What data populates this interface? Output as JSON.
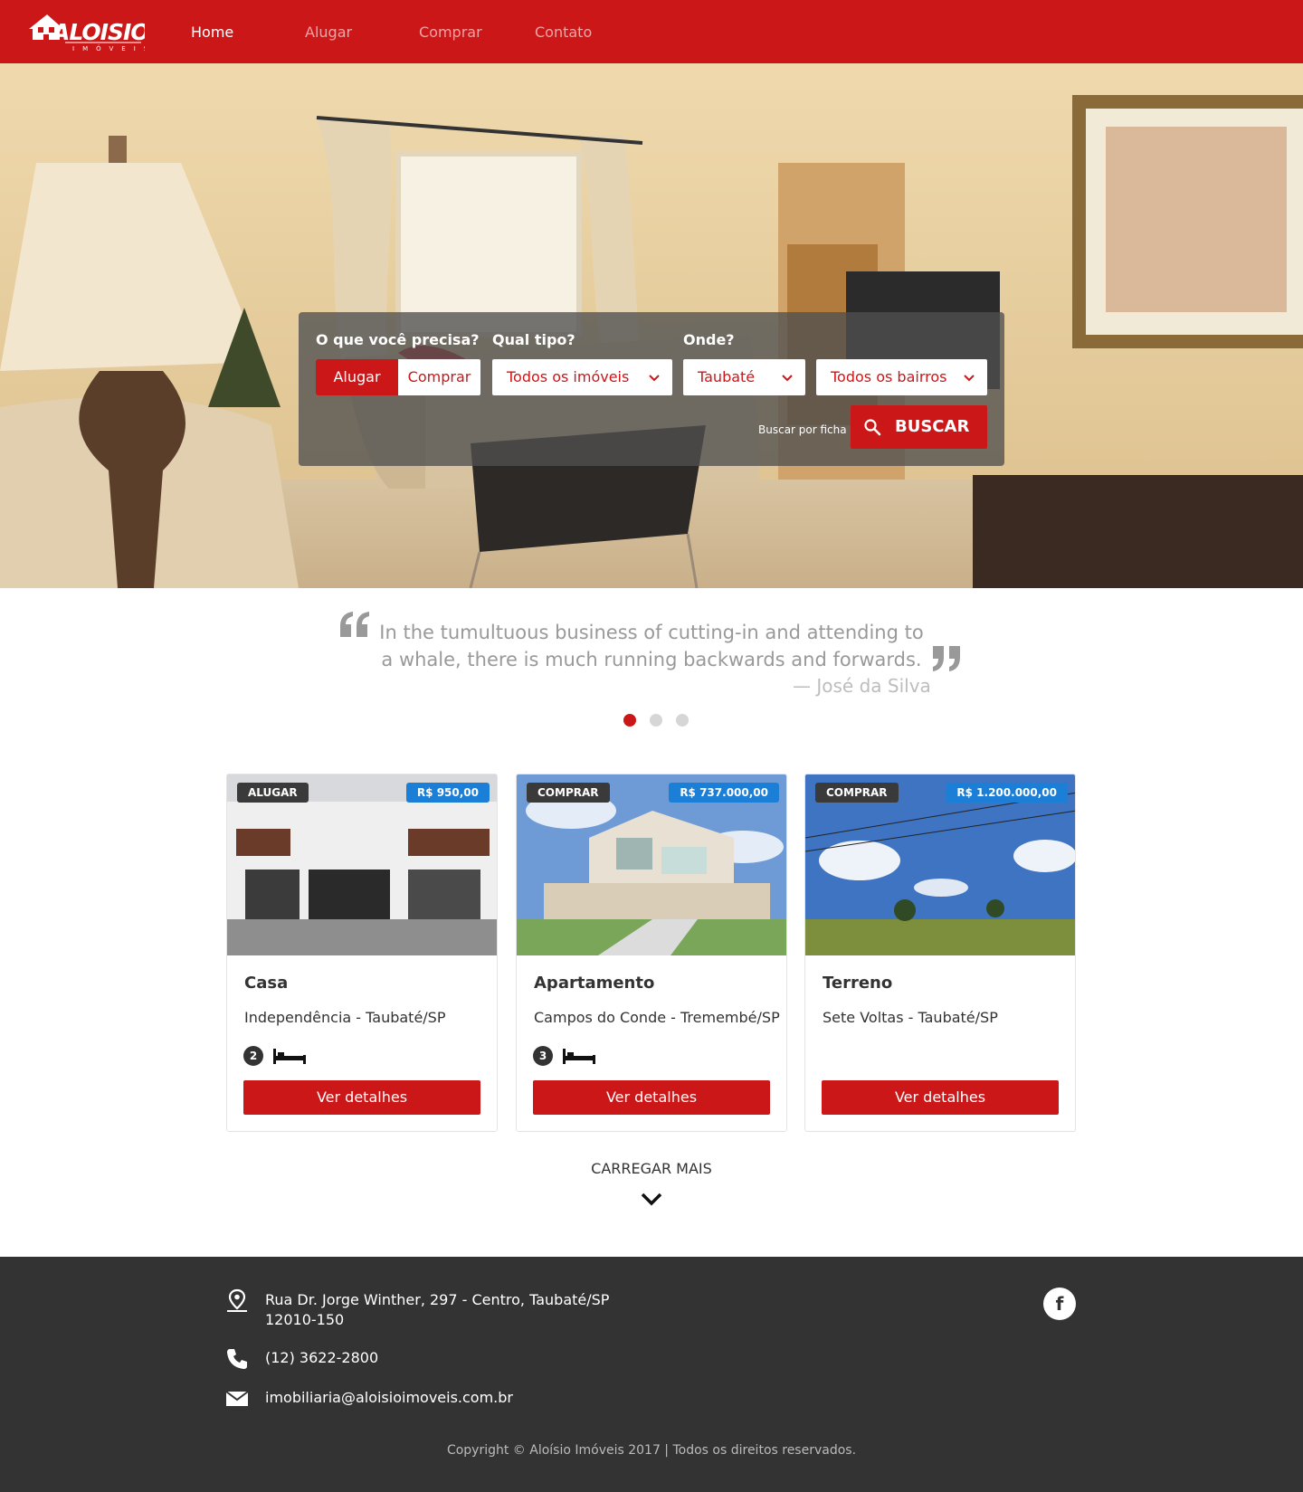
{
  "header": {
    "logo_text": "ALOISIO",
    "logo_sub": "IMÓVEIS",
    "nav": [
      {
        "label": "Home",
        "active": true
      },
      {
        "label": "Alugar",
        "active": false
      },
      {
        "label": "Comprar",
        "active": false
      },
      {
        "label": "Contato",
        "active": false
      }
    ]
  },
  "search": {
    "need_label": "O que você precisa?",
    "type_label": "Qual tipo?",
    "where_label": "Onde?",
    "toggle_rent": "Alugar",
    "toggle_buy": "Comprar",
    "type_value": "Todos os imóveis",
    "city_value": "Taubaté",
    "district_value": "Todos os bairros",
    "by_code_link": "Buscar por ficha",
    "submit_label": "BUSCAR"
  },
  "testimonial": {
    "text": "In the tumultuous business of cutting-in and attending to a whale, there is much running backwards and forwards.",
    "author": "— José da Silva",
    "slides": 3,
    "active_slide": 0
  },
  "listings": [
    {
      "badge": "ALUGAR",
      "price": "R$ 950,00",
      "title": "Casa",
      "location": "Independência - Taubaté/SP",
      "bedrooms": "2",
      "button": "Ver detalhes"
    },
    {
      "badge": "COMPRAR",
      "price": "R$ 737.000,00",
      "title": "Apartamento",
      "location": "Campos do Conde - Tremembé/SP",
      "bedrooms": "3",
      "button": "Ver detalhes"
    },
    {
      "badge": "COMPRAR",
      "price": "R$ 1.200.000,00",
      "title": "Terreno",
      "location": "Sete Voltas - Taubaté/SP",
      "bedrooms": null,
      "button": "Ver detalhes"
    }
  ],
  "load_more": "CARREGAR MAIS",
  "footer": {
    "address_line1": "Rua Dr. Jorge Winther, 297 - Centro, Taubaté/SP",
    "address_line2": "12010-150",
    "phone": "(12) 3622-2800",
    "email": "imobiliaria@aloisioimoveis.com.br",
    "social_icon": "facebook-icon",
    "copyright": "Copyright © Aloísio Imóveis 2017 | Todos os direitos reservados."
  },
  "colors": {
    "brand_red": "#cc1719",
    "price_blue": "#1b7fd8",
    "footer_bg": "#333333"
  }
}
